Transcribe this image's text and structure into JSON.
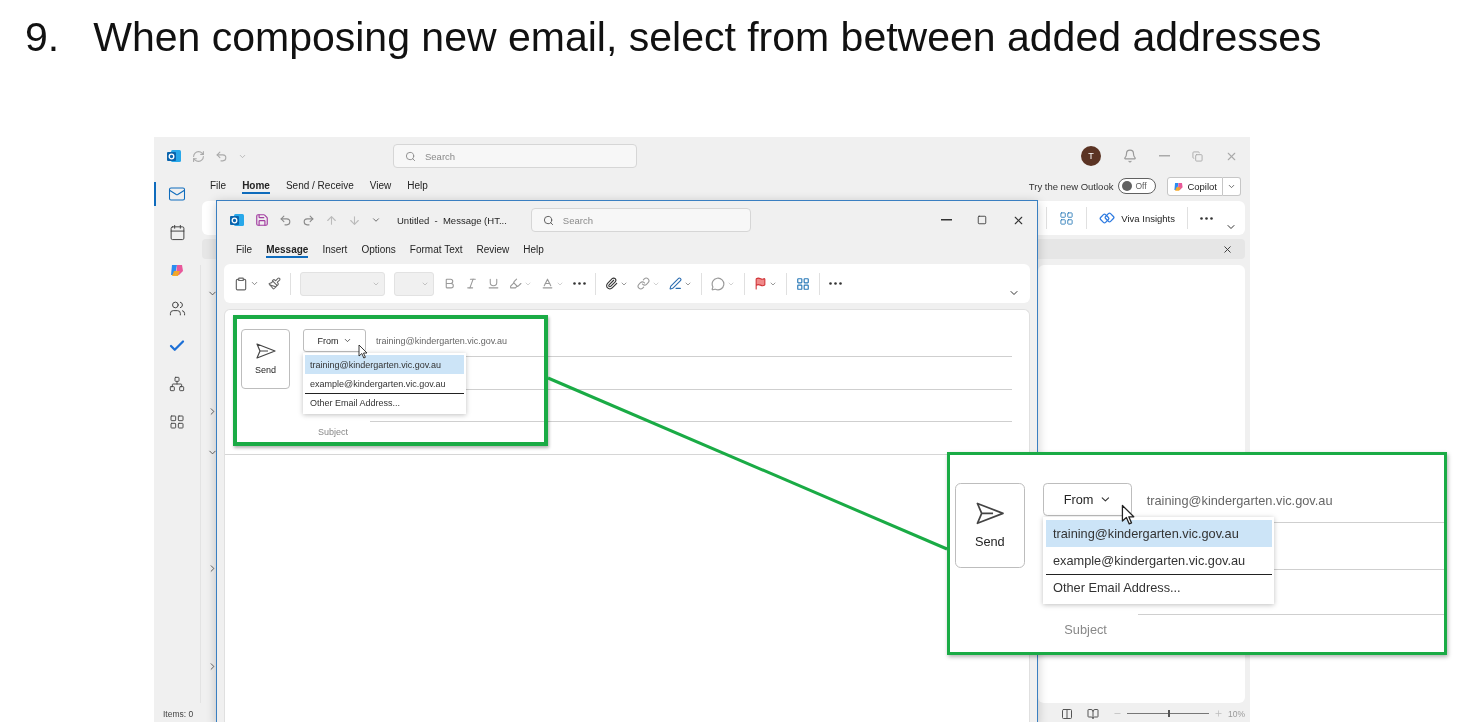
{
  "slide": {
    "number": "9.",
    "title": "When composing new email, select from between added addresses"
  },
  "outlook": {
    "search_placeholder": "Search",
    "avatar": "T",
    "rail": [
      {
        "selected": true
      },
      {
        "selected": false
      },
      {
        "selected": false
      },
      {
        "selected": false
      },
      {
        "selected": false
      },
      {
        "selected": false
      },
      {
        "selected": false
      }
    ],
    "menu": [
      {
        "label": "File",
        "selected": false
      },
      {
        "label": "Home",
        "selected": true
      },
      {
        "label": "Send / Receive",
        "selected": false
      },
      {
        "label": "View",
        "selected": false
      },
      {
        "label": "Help",
        "selected": false
      }
    ],
    "try_new_outlook": "Try the new Outlook",
    "toggle": {
      "label": "Off",
      "on": false
    },
    "copilot": "Copilot",
    "ribbon": {
      "viva_insights": "Viva Insights"
    },
    "status": {
      "items": "Items: 0",
      "zoom": {
        "reading": "10%",
        "level": 0.5
      }
    }
  },
  "compose": {
    "title": "Untitled  -  Message (HT...",
    "search_placeholder": "Search",
    "menu": [
      {
        "label": "File",
        "selected": false
      },
      {
        "label": "Message",
        "selected": true
      },
      {
        "label": "Insert",
        "selected": false
      },
      {
        "label": "Options",
        "selected": false
      },
      {
        "label": "Format Text",
        "selected": false
      },
      {
        "label": "Review",
        "selected": false
      },
      {
        "label": "Help",
        "selected": false
      }
    ],
    "header": {
      "send": "Send",
      "from": "From",
      "from_value": "training@kindergarten.vic.gov.au",
      "addresses": [
        {
          "kind": "address",
          "label": "training@kindergarten.vic.gov.au",
          "selected": true
        },
        {
          "kind": "address",
          "label": "example@kindergarten.vic.gov.au",
          "selected": false
        },
        {
          "kind": "action",
          "label": "Other Email Address...",
          "selected": false
        }
      ],
      "subject": "Subject"
    }
  },
  "callout": {
    "header": {
      "send": "Send",
      "from": "From",
      "from_value": "training@kindergarten.vic.gov.au",
      "addresses": [
        {
          "kind": "address",
          "label": "training@kindergarten.vic.gov.au",
          "selected": true
        },
        {
          "kind": "address",
          "label": "example@kindergarten.vic.gov.au",
          "selected": false
        },
        {
          "kind": "action",
          "label": "Other Email Address...",
          "selected": false
        }
      ],
      "subject": "Subject"
    }
  }
}
